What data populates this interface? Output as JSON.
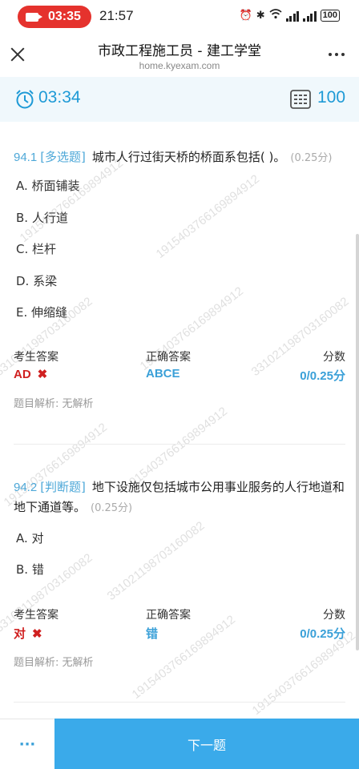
{
  "status_bar": {
    "record_time": "03:35",
    "clock": "21:57",
    "battery": "100"
  },
  "nav": {
    "title": "市政工程施工员 - 建工学堂",
    "subtitle": "home.kyexam.com"
  },
  "timer_bar": {
    "remaining": "03:34",
    "total_questions": "100"
  },
  "questions": [
    {
      "number": "94.1",
      "type": "[多选题]",
      "text": "城市人行过街天桥的桥面系包括( )。",
      "score": "(0.25分)",
      "options": [
        "A. 桥面铺装",
        "B. 人行道",
        "C. 栏杆",
        "D. 系梁",
        "E. 伸缩缝"
      ],
      "labels": {
        "mine": "考生答案",
        "correct": "正确答案",
        "score": "分数"
      },
      "my_answer": "AD",
      "correct_answer": "ABCE",
      "result_score": "0/0.25分",
      "analysis": "题目解析:  无解析"
    },
    {
      "number": "94.2",
      "type": "[判断题]",
      "text": "地下设施仅包括城市公用事业服务的人行地道和地下通道等。",
      "score": "(0.25分)",
      "options": [
        "A. 对",
        "B. 错"
      ],
      "labels": {
        "mine": "考生答案",
        "correct": "正确答案",
        "score": "分数"
      },
      "my_answer": "对",
      "correct_answer": "错",
      "result_score": "0/0.25分",
      "analysis": "题目解析:  无解析"
    }
  ],
  "watermark_text": "33102119870316008​2",
  "watermark_text_2": "19154037661​6989491​2",
  "bottom": {
    "menu_label": "···",
    "next_label": "下一题"
  },
  "colors": {
    "accent": "#3aaaea",
    "wrong": "#d02020",
    "timer_bg": "#f0f8fc"
  }
}
